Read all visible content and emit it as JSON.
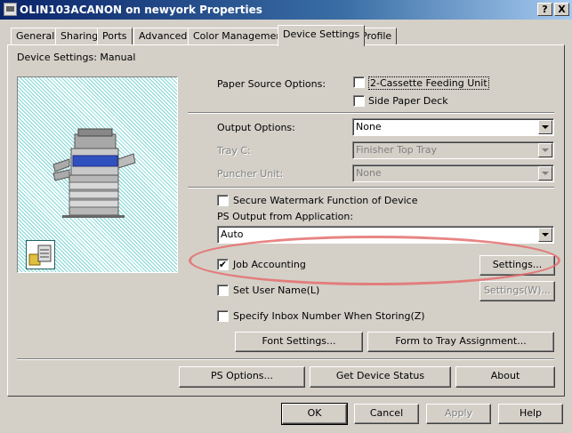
{
  "window": {
    "title": "OLIN103ACANON on newyork Properties",
    "help_btn": "?",
    "close_btn": "X"
  },
  "tabs": [
    "General",
    "Sharing",
    "Ports",
    "Advanced",
    "Color Management",
    "Device Settings",
    "Profile"
  ],
  "active_tab": "Device Settings",
  "device_settings_label": "Device Settings: Manual",
  "paper_source": {
    "label": "Paper Source Options:",
    "options": [
      {
        "label": "2-Cassette Feeding Unit",
        "checked": false
      },
      {
        "label": "Side Paper Deck",
        "checked": false
      }
    ]
  },
  "output_options": {
    "label": "Output Options:",
    "value": "None"
  },
  "tray_c": {
    "label": "Tray C:",
    "value": "Finisher Top Tray"
  },
  "puncher_unit": {
    "label": "Puncher Unit:",
    "value": "None"
  },
  "secure_watermark": {
    "label": "Secure Watermark Function of Device",
    "checked": false
  },
  "ps_output": {
    "label": "PS Output from Application:",
    "value": "Auto"
  },
  "job_accounting": {
    "label": "Job Accounting",
    "checked": true,
    "settings_btn": "Settings..."
  },
  "set_user_name": {
    "label": "Set User Name(L)",
    "checked": false,
    "settings_btn": "Settings(W)..."
  },
  "specify_inbox": {
    "label": "Specify Inbox Number When Storing(Z)",
    "checked": false
  },
  "buttons": {
    "font_settings": "Font Settings...",
    "form_to_tray": "Form to Tray Assignment...",
    "ps_options": "PS Options...",
    "get_device_status": "Get Device Status",
    "about": "About",
    "ok": "OK",
    "cancel": "Cancel",
    "apply": "Apply",
    "help": "Help"
  },
  "check_mark": "✔",
  "colors": {
    "highlight": "#e46e6e",
    "titlebar": "#0a246a"
  }
}
